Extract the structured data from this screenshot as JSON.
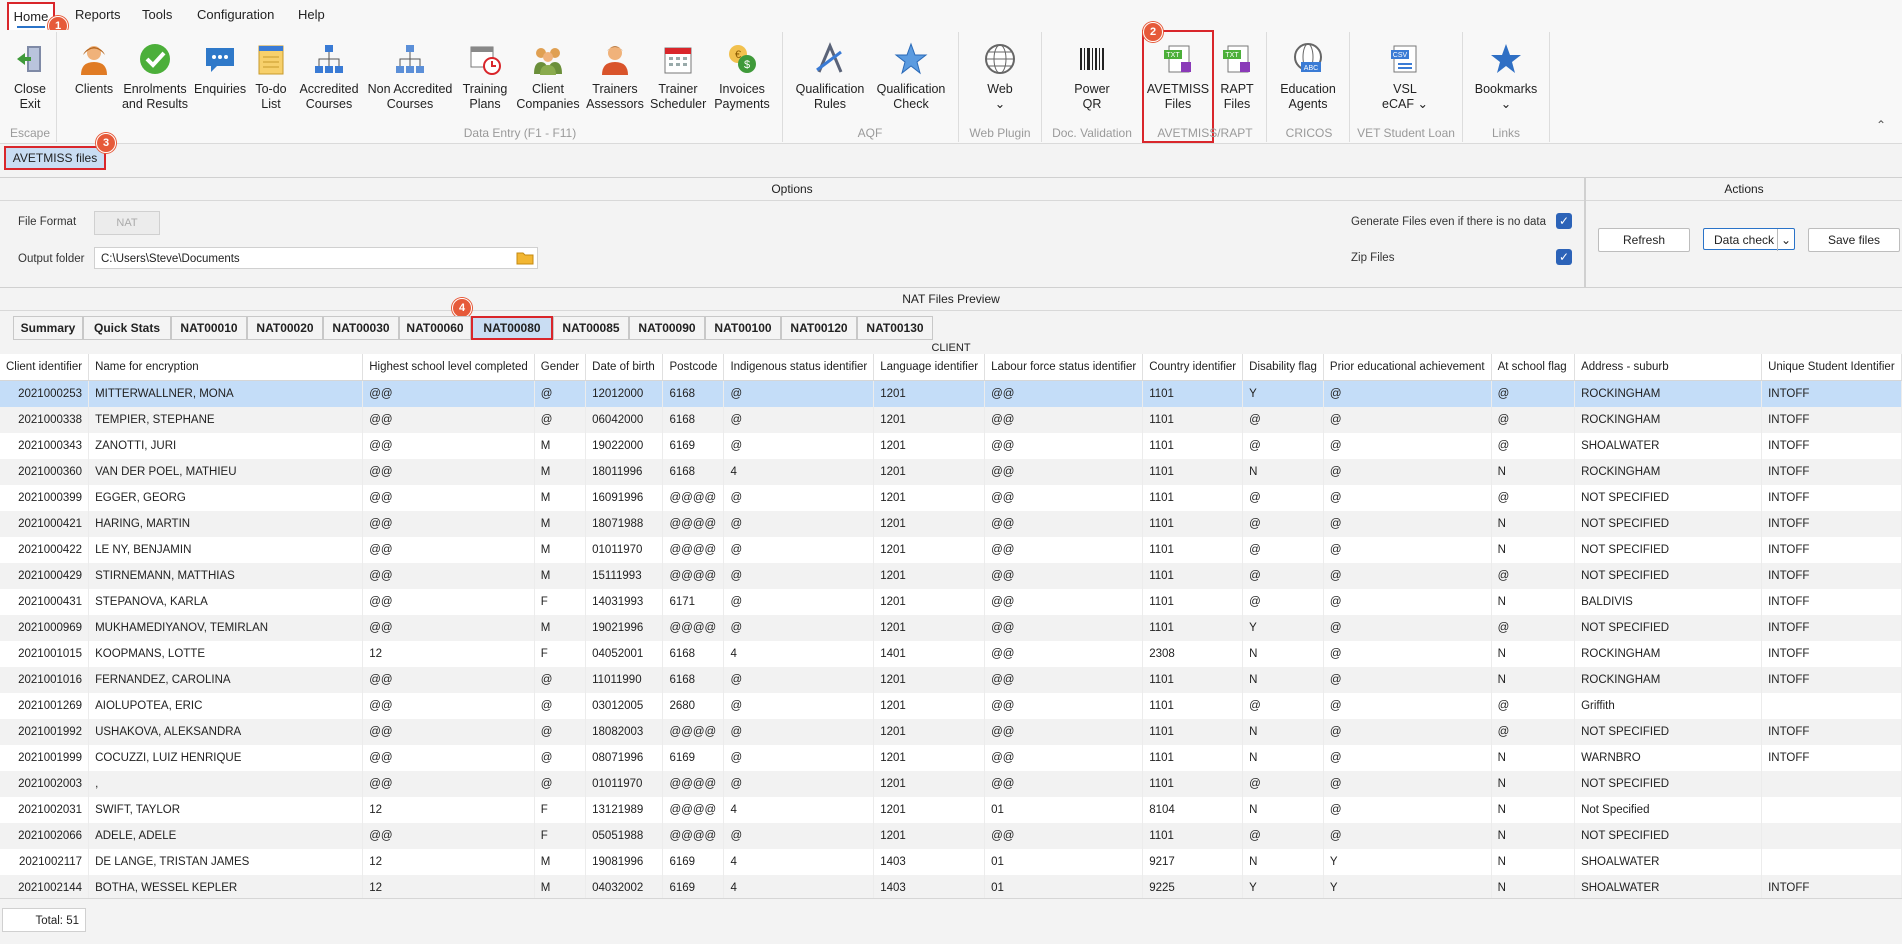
{
  "menu": {
    "home": "Home",
    "reports": "Reports",
    "tools": "Tools",
    "configuration": "Configuration",
    "help": "Help"
  },
  "badges": {
    "b1": "1",
    "b2": "2",
    "b3": "3",
    "b4": "4"
  },
  "ribbon": {
    "close_exit": [
      "Close",
      "Exit"
    ],
    "clients": "Clients",
    "enrolments": [
      "Enrolments",
      "and Results"
    ],
    "enquiries": "Enquiries",
    "todo": [
      "To-do",
      "List"
    ],
    "accredited": [
      "Accredited",
      "Courses"
    ],
    "non_accredited": [
      "Non Accredited",
      "Courses"
    ],
    "training_plans": [
      "Training",
      "Plans"
    ],
    "client_companies": [
      "Client",
      "Companies"
    ],
    "trainers_assessors": [
      "Trainers",
      "Assessors"
    ],
    "trainer_scheduler": [
      "Trainer",
      "Scheduler"
    ],
    "invoices_payments": [
      "Invoices",
      "Payments"
    ],
    "qual_rules": [
      "Qualification",
      "Rules"
    ],
    "qual_check": [
      "Qualification",
      "Check"
    ],
    "web": "Web",
    "power_qr": [
      "Power",
      "QR"
    ],
    "avetmiss_files": [
      "AVETMISS",
      "Files"
    ],
    "rapt_files": [
      "RAPT",
      "Files"
    ],
    "education_agents": [
      "Education",
      "Agents"
    ],
    "vsl": [
      "VSL",
      "eCAF"
    ],
    "bookmarks": "Bookmarks",
    "groups": {
      "escape": "Escape",
      "data_entry": "Data Entry (F1 - F11)",
      "aqf": "AQF",
      "web_plugin": "Web Plugin",
      "doc_validation": "Doc. Validation",
      "avetmiss_rapt": "AVETMISS/RAPT",
      "cricos": "CRICOS",
      "vsl": "VET Student Loan",
      "links": "Links"
    }
  },
  "subtab": "AVETMISS files",
  "options": {
    "header": "Options",
    "file_format_label": "File Format",
    "file_format_value": "NAT",
    "output_folder_label": "Output folder",
    "output_folder_value": "C:\\Users\\Steve\\Documents",
    "generate_label": "Generate Files even if there is no data",
    "generate_checked": true,
    "zip_label": "Zip Files",
    "zip_checked": true
  },
  "actions": {
    "header": "Actions",
    "refresh": "Refresh",
    "data_check": "Data check",
    "save_files": "Save files"
  },
  "preview_header": "NAT Files Preview",
  "tabs": [
    "Summary",
    "Quick Stats",
    "NAT00010",
    "NAT00020",
    "NAT00030",
    "NAT00060",
    "NAT00080",
    "NAT00085",
    "NAT00090",
    "NAT00100",
    "NAT00120",
    "NAT00130"
  ],
  "active_tab": "NAT00080",
  "grid_title": "CLIENT",
  "columns": [
    "Client identifier",
    "Name for encryption",
    "Highest school level completed",
    "Gender",
    "Date of birth",
    "Postcode",
    "Indigenous status identifier",
    "Language identifier",
    "Labour force status identifier",
    "Country identifier",
    "Disability flag",
    "Prior educational achievement",
    "At school flag",
    "Address - suburb",
    "Unique Student Identifier"
  ],
  "rows": [
    [
      "2021000253",
      "MITTERWALLNER, MONA",
      "@@",
      "@",
      "12012000",
      "6168",
      "@",
      "1201",
      "@@",
      "1101",
      "Y",
      "@",
      "@",
      "ROCKINGHAM",
      "INTOFF"
    ],
    [
      "2021000338",
      "TEMPIER, STEPHANE",
      "@@",
      "@",
      "06042000",
      "6168",
      "@",
      "1201",
      "@@",
      "1101",
      "@",
      "@",
      "@",
      "ROCKINGHAM",
      "INTOFF"
    ],
    [
      "2021000343",
      "ZANOTTI, JURI",
      "@@",
      "M",
      "19022000",
      "6169",
      "@",
      "1201",
      "@@",
      "1101",
      "@",
      "@",
      "@",
      "SHOALWATER",
      "INTOFF"
    ],
    [
      "2021000360",
      "VAN DER POEL, MATHIEU",
      "@@",
      "M",
      "18011996",
      "6168",
      "4",
      "1201",
      "@@",
      "1101",
      "N",
      "@",
      "N",
      "ROCKINGHAM",
      "INTOFF"
    ],
    [
      "2021000399",
      "EGGER, GEORG",
      "@@",
      "M",
      "16091996",
      "@@@@",
      "@",
      "1201",
      "@@",
      "1101",
      "@",
      "@",
      "@",
      "NOT SPECIFIED",
      "INTOFF"
    ],
    [
      "2021000421",
      "HARING, MARTIN",
      "@@",
      "M",
      "18071988",
      "@@@@",
      "@",
      "1201",
      "@@",
      "1101",
      "@",
      "@",
      "N",
      "NOT SPECIFIED",
      "INTOFF"
    ],
    [
      "2021000422",
      "LE NY, BENJAMIN",
      "@@",
      "M",
      "01011970",
      "@@@@",
      "@",
      "1201",
      "@@",
      "1101",
      "@",
      "@",
      "N",
      "NOT SPECIFIED",
      "INTOFF"
    ],
    [
      "2021000429",
      "STIRNEMANN, MATTHIAS",
      "@@",
      "M",
      "15111993",
      "@@@@",
      "@",
      "1201",
      "@@",
      "1101",
      "@",
      "@",
      "@",
      "NOT SPECIFIED",
      "INTOFF"
    ],
    [
      "2021000431",
      "STEPANOVA, KARLA",
      "@@",
      "F",
      "14031993",
      "6171",
      "@",
      "1201",
      "@@",
      "1101",
      "@",
      "@",
      "N",
      "BALDIVIS",
      "INTOFF"
    ],
    [
      "2021000969",
      "MUKHAMEDIYANOV, TEMIRLAN",
      "@@",
      "M",
      "19021996",
      "@@@@",
      "@",
      "1201",
      "@@",
      "1101",
      "Y",
      "@",
      "@",
      "NOT SPECIFIED",
      "INTOFF"
    ],
    [
      "2021001015",
      "KOOPMANS, LOTTE",
      "12",
      "F",
      "04052001",
      "6168",
      "4",
      "1401",
      "@@",
      "2308",
      "N",
      "@",
      "N",
      "ROCKINGHAM",
      "INTOFF"
    ],
    [
      "2021001016",
      "FERNANDEZ, CAROLINA",
      "@@",
      "@",
      "11011990",
      "6168",
      "@",
      "1201",
      "@@",
      "1101",
      "N",
      "@",
      "N",
      "ROCKINGHAM",
      "INTOFF"
    ],
    [
      "2021001269",
      "AIOLUPOTEA, ERIC",
      "@@",
      "@",
      "03012005",
      "2680",
      "@",
      "1201",
      "@@",
      "1101",
      "@",
      "@",
      "@",
      "Griffith",
      ""
    ],
    [
      "2021001992",
      "USHAKOVA, ALEKSANDRA",
      "@@",
      "@",
      "18082003",
      "@@@@",
      "@",
      "1201",
      "@@",
      "1101",
      "N",
      "@",
      "@",
      "NOT SPECIFIED",
      "INTOFF"
    ],
    [
      "2021001999",
      "COCUZZI, LUIZ HENRIQUE",
      "@@",
      "@",
      "08071996",
      "6169",
      "@",
      "1201",
      "@@",
      "1101",
      "N",
      "@",
      "N",
      "WARNBRO",
      "INTOFF"
    ],
    [
      "2021002003",
      ",",
      "@@",
      "@",
      "01011970",
      "@@@@",
      "@",
      "1201",
      "@@",
      "1101",
      "@",
      "@",
      "N",
      "NOT SPECIFIED",
      ""
    ],
    [
      "2021002031",
      "SWIFT, TAYLOR",
      "12",
      "F",
      "13121989",
      "@@@@",
      "4",
      "1201",
      "01",
      "8104",
      "N",
      "@",
      "N",
      "Not Specified",
      ""
    ],
    [
      "2021002066",
      "ADELE, ADELE",
      "@@",
      "F",
      "05051988",
      "@@@@",
      "@",
      "1201",
      "@@",
      "1101",
      "@",
      "@",
      "N",
      "NOT SPECIFIED",
      ""
    ],
    [
      "2021002117",
      "DE LANGE, TRISTAN JAMES",
      "12",
      "M",
      "19081996",
      "6169",
      "4",
      "1403",
      "01",
      "9217",
      "N",
      "Y",
      "N",
      "SHOALWATER",
      ""
    ],
    [
      "2021002144",
      "BOTHA, WESSEL KEPLER",
      "12",
      "M",
      "04032002",
      "6169",
      "4",
      "1403",
      "01",
      "9225",
      "Y",
      "Y",
      "N",
      "SHOALWATER",
      "INTOFF"
    ]
  ],
  "footer": {
    "total": "Total: 51"
  },
  "colors": {
    "accent": "#2a73c8",
    "highlight_red": "#d9262b",
    "badge": "#e65a3a",
    "selection": "#c4ddf8"
  }
}
